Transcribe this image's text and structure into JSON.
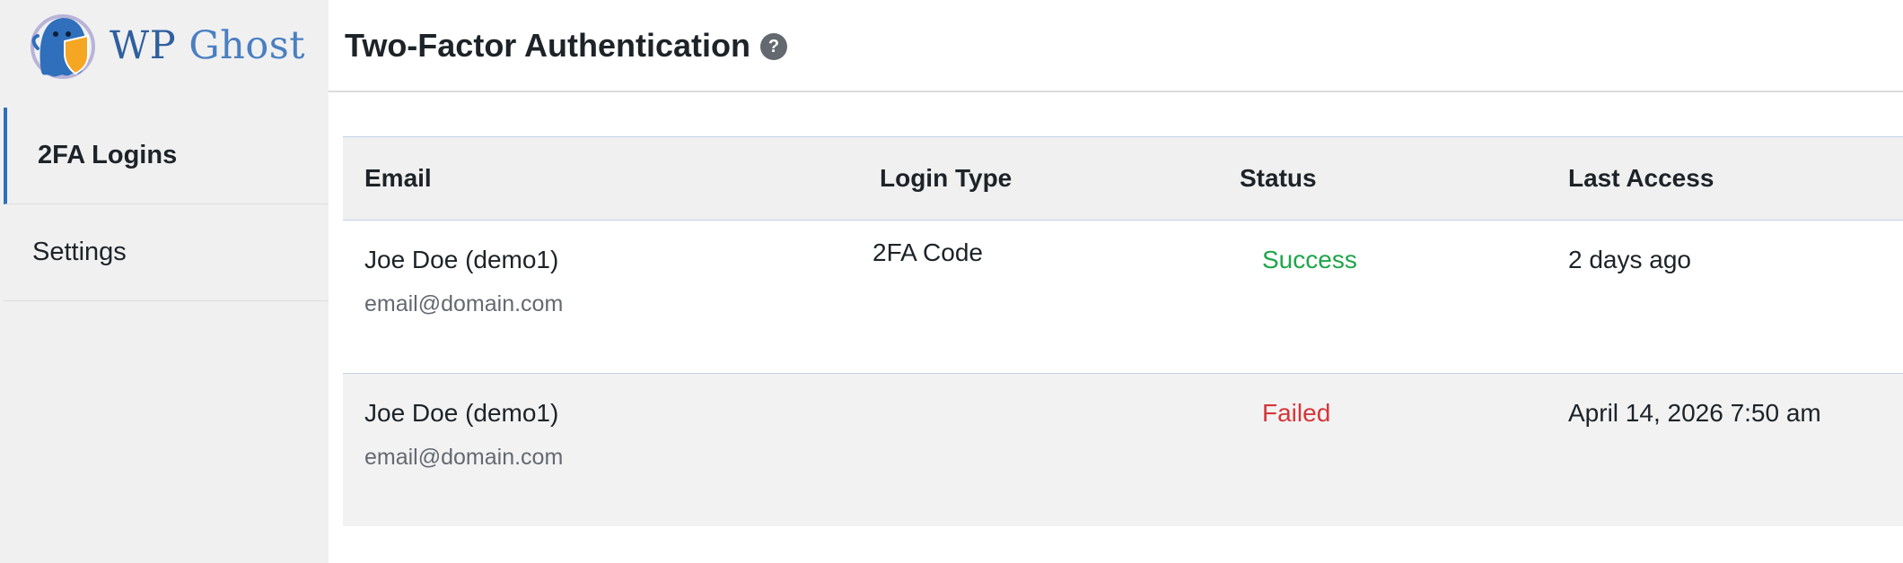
{
  "brand": {
    "name_part1": "WP",
    "name_part2": "Ghost"
  },
  "sidebar": {
    "items": [
      {
        "label": "2FA Logins",
        "active": true
      },
      {
        "label": "Settings",
        "active": false
      }
    ]
  },
  "header": {
    "title": "Two-Factor Authentication",
    "help_icon": "?"
  },
  "table": {
    "columns": [
      "Email",
      "Login Type",
      "Status",
      "Last Access"
    ],
    "rows": [
      {
        "name": "Joe Doe (demo1)",
        "email": "email@domain.com",
        "login_type": "2FA Code",
        "status": "Success",
        "last_access": "2 days ago"
      },
      {
        "name": "Joe Doe (demo1)",
        "email": "email@domain.com",
        "login_type": "",
        "status": "Failed",
        "last_access": "April 14, 2026 7:50 am"
      }
    ]
  },
  "colors": {
    "accent": "#2f6fbb",
    "success": "#1fa64a",
    "failed": "#d63638",
    "sidebar_bg": "#f0f0f1"
  },
  "icons": {
    "logo": "ghost-shield-logo-icon",
    "help": "question-circle-icon"
  }
}
